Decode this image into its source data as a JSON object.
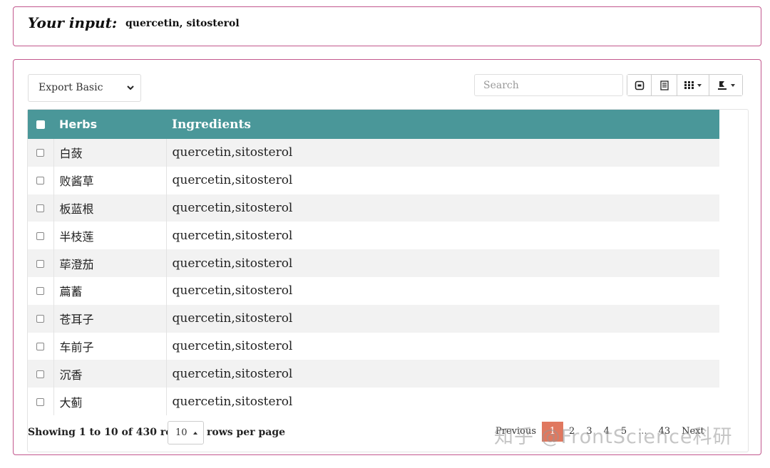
{
  "input_panel": {
    "label": "Your input:",
    "value": "quercetin, sitosterol"
  },
  "toolbar": {
    "export_select": "Export Basic",
    "search_placeholder": "Search",
    "buttons": [
      "toggle-icon",
      "card-view-icon",
      "columns-icon",
      "export-icon"
    ]
  },
  "table": {
    "headers": {
      "herbs": "Herbs",
      "ingredients": "Ingredients"
    },
    "rows": [
      {
        "herb": "白蔹",
        "ingredients": "quercetin,sitosterol"
      },
      {
        "herb": "败酱草",
        "ingredients": "quercetin,sitosterol"
      },
      {
        "herb": "板蓝根",
        "ingredients": "quercetin,sitosterol"
      },
      {
        "herb": "半枝莲",
        "ingredients": "quercetin,sitosterol"
      },
      {
        "herb": "荜澄茄",
        "ingredients": "quercetin,sitosterol"
      },
      {
        "herb": "萹蓄",
        "ingredients": "quercetin,sitosterol"
      },
      {
        "herb": "苍耳子",
        "ingredients": "quercetin,sitosterol"
      },
      {
        "herb": "车前子",
        "ingredients": "quercetin,sitosterol"
      },
      {
        "herb": "沉香",
        "ingredients": "quercetin,sitosterol"
      },
      {
        "herb": "大蓟",
        "ingredients": "quercetin,sitosterol"
      }
    ]
  },
  "footer": {
    "showing": "Showing 1 to 10 of 430 rows",
    "page_size": "10",
    "rows_per_page": "rows per page"
  },
  "pagination": {
    "previous": "Previous",
    "pages": [
      "1",
      "2",
      "3",
      "4",
      "5"
    ],
    "ellipsis": "...",
    "last": "43",
    "next": "Next",
    "active": "1"
  },
  "watermark": "知乎 @FrontScience科研",
  "colors": {
    "header_bg": "#4a9799",
    "panel_border": "#c2578d",
    "active_page": "#e0785f"
  }
}
